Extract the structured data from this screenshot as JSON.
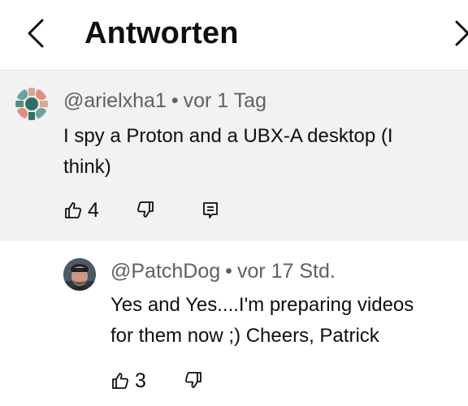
{
  "header": {
    "title": "Antworten"
  },
  "parent_comment": {
    "author": "@arielxha1",
    "separator": "•",
    "time": "vor 1 Tag",
    "text_line1": "I spy a Proton and a UBX-A desktop (I",
    "text_line2": "think)",
    "like_count": "4"
  },
  "reply_comment": {
    "author": "@PatchDog",
    "separator": "•",
    "time": "vor 17 Std.",
    "text_line1": "Yes and Yes....I'm preparing videos",
    "text_line2": "for them now ;) Cheers, Patrick",
    "like_count": "3"
  },
  "icons": {
    "back": "chevron-left-icon",
    "close": "close-icon",
    "like": "thumbs-up-icon",
    "dislike": "thumbs-down-icon",
    "reply": "comment-icon"
  },
  "colors": {
    "highlight_bg": "#f2f2f2",
    "meta_text": "#606060",
    "text": "#0f0f0f"
  }
}
